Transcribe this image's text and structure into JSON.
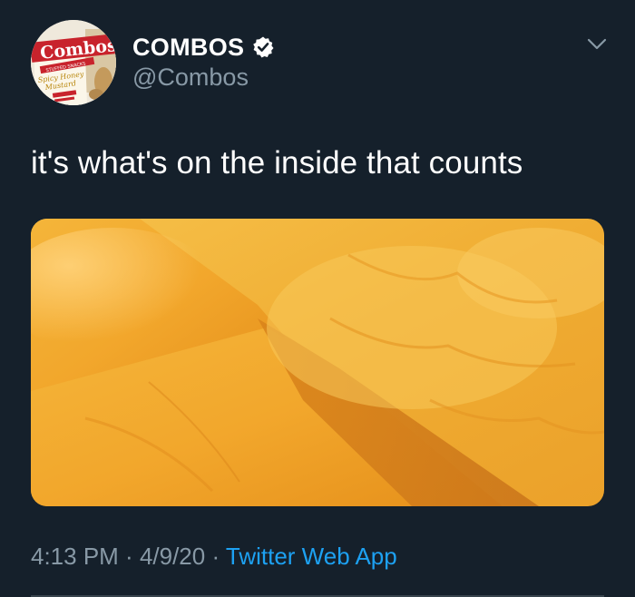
{
  "tweet": {
    "display_name": "COMBOS",
    "handle": "@Combos",
    "verified": true,
    "text": "it's what's on the inside that counts",
    "timestamp_time": "4:13 PM",
    "separator": " · ",
    "timestamp_date": "4/9/20",
    "source": "Twitter Web App"
  },
  "avatar": {
    "brand_text": "Combos",
    "tag_text": "STUFFED SNACKS",
    "flavor_line1": "Spicy Honey",
    "flavor_line2": "Mustard"
  },
  "icons": {
    "verified": "verified-badge-icon",
    "more": "chevron-down-icon"
  },
  "colors": {
    "background": "#15202b",
    "primary_text": "#ffffff",
    "secondary_text": "#8899a6",
    "link": "#1da1f2",
    "divider": "#38444d"
  }
}
